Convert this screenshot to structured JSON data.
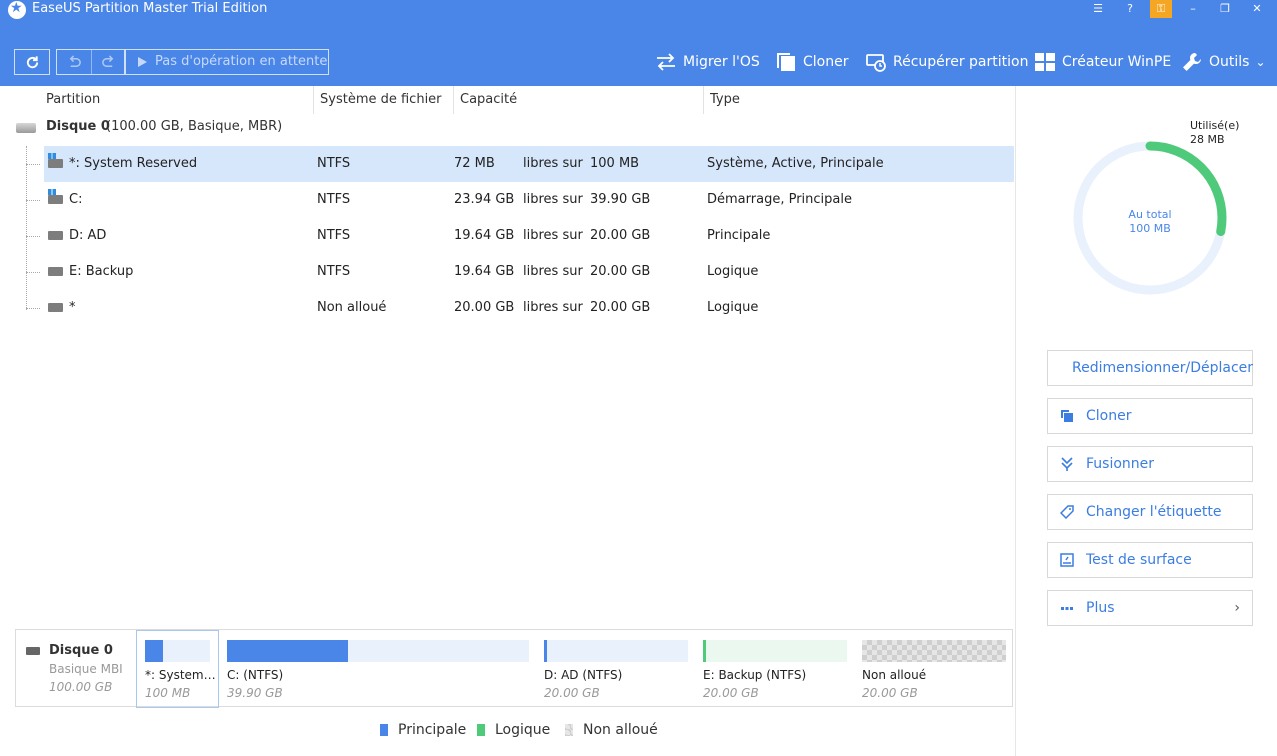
{
  "window": {
    "title": "EaseUS Partition Master Trial Edition"
  },
  "toolbar": {
    "pending_label": "Pas d'opération en attente",
    "tools": [
      {
        "label": "Migrer l'OS",
        "icon": "migrate-icon"
      },
      {
        "label": "Cloner",
        "icon": "clone-icon"
      },
      {
        "label": "Récupérer partition",
        "icon": "recover-icon"
      },
      {
        "label": "Créateur WinPE",
        "icon": "windows-icon"
      },
      {
        "label": "Outils",
        "icon": "wrench-icon"
      }
    ]
  },
  "columns": {
    "partition": "Partition",
    "filesystem": "Système de fichier",
    "capacity": "Capacité",
    "type": "Type"
  },
  "disk": {
    "name": "Disque 0",
    "info": "(100.00 GB, Basique, MBR)"
  },
  "partitions": [
    {
      "name": "*: System Reserved",
      "fs": "NTFS",
      "free": "72 MB",
      "sep": "libres sur",
      "total": "100 MB",
      "type": "Système, Active, Principale"
    },
    {
      "name": "C:",
      "fs": "NTFS",
      "free": "23.94 GB",
      "sep": "libres sur",
      "total": "39.90 GB",
      "type": "Démarrage, Principale"
    },
    {
      "name": "D: AD",
      "fs": "NTFS",
      "free": "19.64 GB",
      "sep": "libres sur",
      "total": "20.00 GB",
      "type": "Principale"
    },
    {
      "name": "E: Backup",
      "fs": "NTFS",
      "free": "19.64 GB",
      "sep": "libres sur",
      "total": "20.00 GB",
      "type": "Logique"
    },
    {
      "name": "*",
      "fs": "Non alloué",
      "free": "20.00 GB",
      "sep": "libres sur",
      "total": "20.00 GB",
      "type": "Logique"
    }
  ],
  "disk_map": {
    "name": "Disque 0",
    "sub": "Basique MBI",
    "size": "100.00 GB",
    "segments": [
      {
        "label": "*: System…",
        "size": "100 MB",
        "used_fraction": 0.28,
        "kind": "principale"
      },
      {
        "label": "C:  (NTFS)",
        "size": "39.90 GB",
        "used_fraction": 0.4,
        "kind": "principale"
      },
      {
        "label": "D: AD (NTFS)",
        "size": "20.00 GB",
        "used_fraction": 0.018,
        "kind": "principale"
      },
      {
        "label": "E: Backup (NTFS)",
        "size": "20.00 GB",
        "used_fraction": 0.018,
        "kind": "logique"
      },
      {
        "label": "Non alloué",
        "size": "20.00 GB",
        "used_fraction": 0,
        "kind": "non-alloue"
      }
    ]
  },
  "legend": {
    "principale": "Principale",
    "logique": "Logique",
    "non_alloue": "Non alloué"
  },
  "usage": {
    "used_label": "Utilisé(e)",
    "used_value": "28 MB",
    "total_label": "Au total",
    "total_value": "100 MB",
    "used_fraction": 0.28
  },
  "actions": [
    {
      "label": "Redimensionner/Déplacer",
      "icon": "resize-icon"
    },
    {
      "label": "Cloner",
      "icon": "clone-icon"
    },
    {
      "label": "Fusionner",
      "icon": "merge-icon"
    },
    {
      "label": "Changer l'étiquette",
      "icon": "tag-icon"
    },
    {
      "label": "Test de surface",
      "icon": "surface-test-icon"
    },
    {
      "label": "Plus",
      "icon": "more-icon"
    }
  ],
  "colors": {
    "header": "#4a86e8",
    "principale": "#4a86e8",
    "logique": "#4fc97a",
    "selection": "#d6e6fb"
  }
}
